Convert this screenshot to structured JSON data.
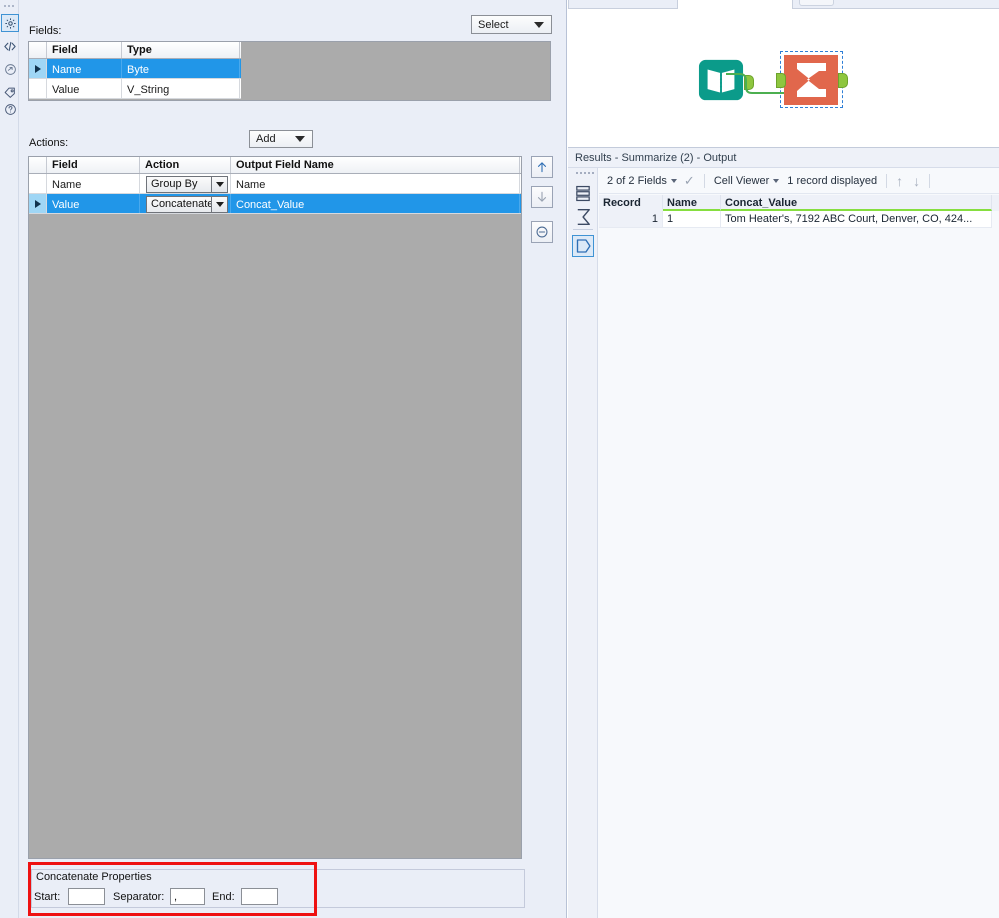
{
  "config_panel": {
    "rail_icons": [
      {
        "name": "gear-icon",
        "label": "Configuration"
      },
      {
        "name": "code-icon",
        "label": "XML View"
      },
      {
        "name": "refresh-icon",
        "label": "Annotation"
      },
      {
        "name": "tag-icon",
        "label": "Label"
      },
      {
        "name": "help-icon",
        "label": "Help"
      }
    ],
    "fields": {
      "label": "Fields:",
      "select_dropdown": "Select",
      "columns": [
        "Field",
        "Type"
      ],
      "rows": [
        {
          "field": "Name",
          "type": "Byte",
          "selected": true
        },
        {
          "field": "Value",
          "type": "V_String",
          "selected": false
        }
      ]
    },
    "actions": {
      "label": "Actions:",
      "add_dropdown": "Add",
      "columns": [
        "Field",
        "Action",
        "Output Field Name"
      ],
      "rows": [
        {
          "field": "Name",
          "action": "Group By",
          "output": "Name",
          "selected": false
        },
        {
          "field": "Value",
          "action": "Concatenate",
          "output": "Concat_Value",
          "selected": true
        }
      ],
      "side_buttons": [
        {
          "name": "move-up-button",
          "glyph": "↑"
        },
        {
          "name": "move-down-button",
          "glyph": "↓"
        },
        {
          "name": "remove-button",
          "glyph": "⊖"
        }
      ]
    },
    "concatenate_properties": {
      "legend": "Concatenate Properties",
      "start_label": "Start:",
      "start_value": "",
      "separator_label": "Separator:",
      "separator_value": ",",
      "end_label": "End:",
      "end_value": ""
    },
    "annotation": {
      "color": "#ee1111"
    }
  },
  "canvas": {
    "nodes": [
      {
        "name": "text-input-node",
        "icon": "book-icon",
        "color": "#0b9b8a"
      },
      {
        "name": "summarize-node",
        "icon": "sigma-icon",
        "color": "#e1674c",
        "selected": true
      }
    ]
  },
  "results": {
    "title": "Results - Summarize (2) - Output",
    "rail_icons": [
      {
        "name": "records-icon"
      },
      {
        "name": "sigma-icon"
      },
      {
        "name": "output-anchor-icon",
        "active": true
      }
    ],
    "toolbar": {
      "fields_selector": "2 of 2 Fields",
      "check_glyph": "✓",
      "view_selector": "Cell Viewer",
      "record_count": "1 record displayed",
      "up_glyph": "↑",
      "down_glyph": "↓"
    },
    "grid": {
      "columns": [
        "Record",
        "Name",
        "Concat_Value"
      ],
      "rows": [
        {
          "record": "1",
          "name": "1",
          "concat_value": "Tom Heater's, 7192 ABC Court, Denver, CO, 424..."
        }
      ]
    },
    "field_underline_color": "#86de3f"
  }
}
